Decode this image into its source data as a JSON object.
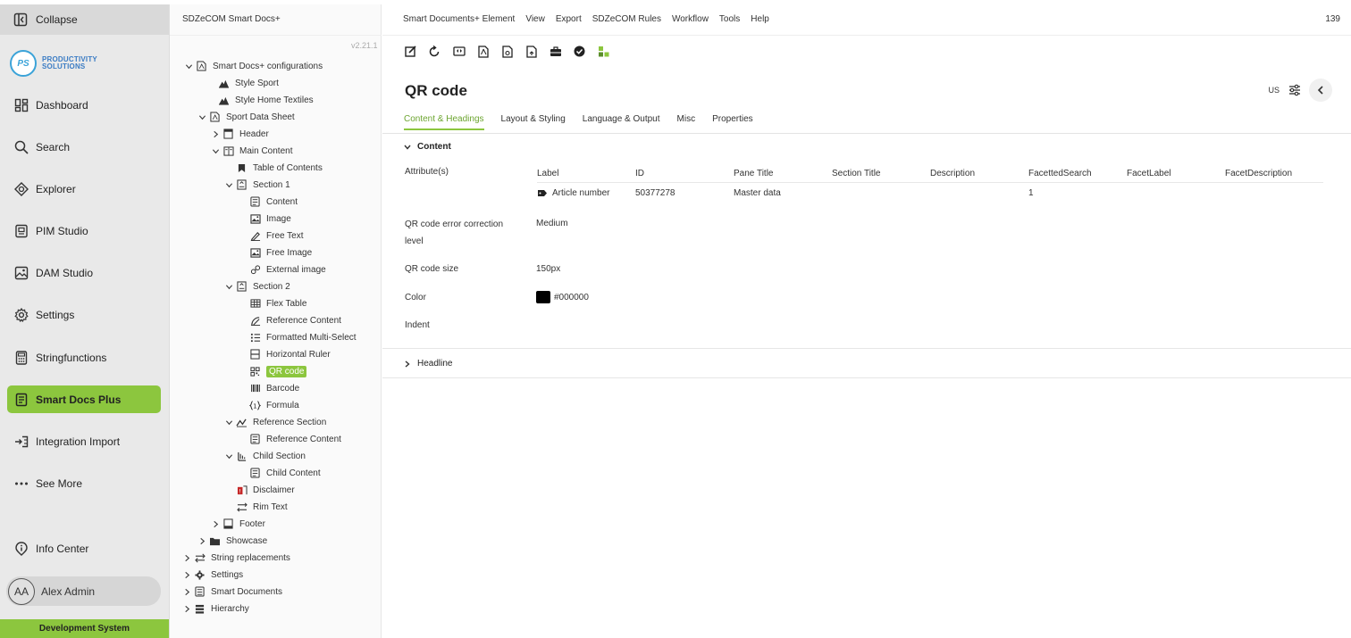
{
  "nav": {
    "collapse_label": "Collapse",
    "logo": {
      "line1": "PRODUCTIVITY",
      "line2": "SOLUTIONS",
      "mark": "PS"
    },
    "items": [
      {
        "label": "Dashboard",
        "icon": "dashboard-icon"
      },
      {
        "label": "Search",
        "icon": "search-icon"
      },
      {
        "label": "Explorer",
        "icon": "explorer-icon"
      },
      {
        "label": "PIM Studio",
        "icon": "pim-studio-icon"
      },
      {
        "label": "DAM Studio",
        "icon": "image-icon"
      },
      {
        "label": "Settings",
        "icon": "gear-icon"
      },
      {
        "label": "Stringfunctions",
        "icon": "calculator-icon"
      },
      {
        "label": "Smart Docs Plus",
        "icon": "document-icon",
        "active": true
      },
      {
        "label": "Integration Import",
        "icon": "import-icon"
      },
      {
        "label": "See More",
        "icon": "more-icon"
      },
      {
        "label": "Info Center",
        "icon": "info-icon"
      }
    ],
    "user": {
      "initials": "AA",
      "name": "Alex Admin"
    },
    "environment": "Development System",
    "accent_color": "#8cc63e"
  },
  "tree": {
    "title": "SDZeCOM Smart Docs+",
    "version": "v2.21.1",
    "nodes": [
      {
        "label": "Smart Docs+ configurations",
        "icon": "pdf-icon",
        "expander": "open"
      },
      {
        "label": "Style Sport",
        "icon": "style-icon"
      },
      {
        "label": "Style Home Textiles",
        "icon": "style-icon"
      },
      {
        "label": "Sport Data Sheet",
        "icon": "pdf-icon",
        "expander": "open"
      },
      {
        "label": "Header",
        "icon": "header-icon",
        "expander": "closed"
      },
      {
        "label": "Main Content",
        "icon": "main-content-icon",
        "expander": "open"
      },
      {
        "label": "Table of Contents",
        "icon": "bookmark-icon"
      },
      {
        "label": "Section 1",
        "icon": "section-icon",
        "expander": "open"
      },
      {
        "label": "Content",
        "icon": "content-icon"
      },
      {
        "label": "Image",
        "icon": "image-icon"
      },
      {
        "label": "Free Text",
        "icon": "pen-icon"
      },
      {
        "label": "Free Image",
        "icon": "image-icon"
      },
      {
        "label": "External image",
        "icon": "link-icon"
      },
      {
        "label": "Section 2",
        "icon": "section-icon",
        "expander": "open"
      },
      {
        "label": "Flex Table",
        "icon": "table-icon"
      },
      {
        "label": "Reference Content",
        "icon": "reference-icon"
      },
      {
        "label": "Formatted Multi-Select",
        "icon": "list-icon"
      },
      {
        "label": "Horizontal Ruler",
        "icon": "ruler-icon"
      },
      {
        "label": "QR code",
        "icon": "qr-icon",
        "selected": true
      },
      {
        "label": "Barcode",
        "icon": "barcode-icon"
      },
      {
        "label": "Formula",
        "icon": "formula-icon"
      },
      {
        "label": "Reference Section",
        "icon": "reference-section-icon",
        "expander": "open"
      },
      {
        "label": "Reference Content",
        "icon": "content-icon"
      },
      {
        "label": "Child Section",
        "icon": "child-section-icon",
        "expander": "open"
      },
      {
        "label": "Child Content",
        "icon": "content-icon"
      },
      {
        "label": "Disclaimer",
        "icon": "disclaimer-icon"
      },
      {
        "label": "Rim Text",
        "icon": "rim-text-icon"
      },
      {
        "label": "Footer",
        "icon": "footer-icon",
        "expander": "closed"
      },
      {
        "label": "Showcase",
        "icon": "folder-icon",
        "expander": "closed"
      },
      {
        "label": "String replacements",
        "icon": "swap-icon",
        "expander": "closed"
      },
      {
        "label": "Settings",
        "icon": "gear-icon",
        "expander": "closed"
      },
      {
        "label": "Smart Documents",
        "icon": "documents-icon",
        "expander": "closed"
      },
      {
        "label": "Hierarchy",
        "icon": "hierarchy-icon",
        "expander": "closed"
      }
    ]
  },
  "menubar": {
    "items": [
      "Smart Documents+ Element",
      "View",
      "Export",
      "SDZeCOM Rules",
      "Workflow",
      "Tools",
      "Help"
    ],
    "page_number": "139"
  },
  "toolbar": {
    "icons": [
      "edit-icon",
      "reload-icon",
      "compare-icon",
      "pdf-export-icon",
      "preview-icon",
      "publish-icon",
      "briefcase-icon",
      "check-icon",
      "workflow-icon"
    ]
  },
  "page": {
    "title": "QR code",
    "language": "US"
  },
  "tabs": [
    "Content & Headings",
    "Layout & Styling",
    "Language & Output",
    "Misc",
    "Properties"
  ],
  "content": {
    "section_label": "Content",
    "attributes_label": "Attribute(s)",
    "columns": [
      "Label",
      "ID",
      "Pane Title",
      "Section Title",
      "Description",
      "FacettedSearch",
      "FacetLabel",
      "FacetDescription"
    ],
    "rows": [
      [
        "Article number",
        "50377278",
        "Master data",
        "",
        "",
        "1",
        "",
        ""
      ]
    ],
    "fields": {
      "error_correction_label": "QR code error correction level",
      "error_correction_value": "Medium",
      "size_label": "QR code size",
      "size_value": "150px",
      "color_label": "Color",
      "color_value": "#000000",
      "indent_label": "Indent"
    }
  },
  "headline": {
    "section_label": "Headline"
  }
}
